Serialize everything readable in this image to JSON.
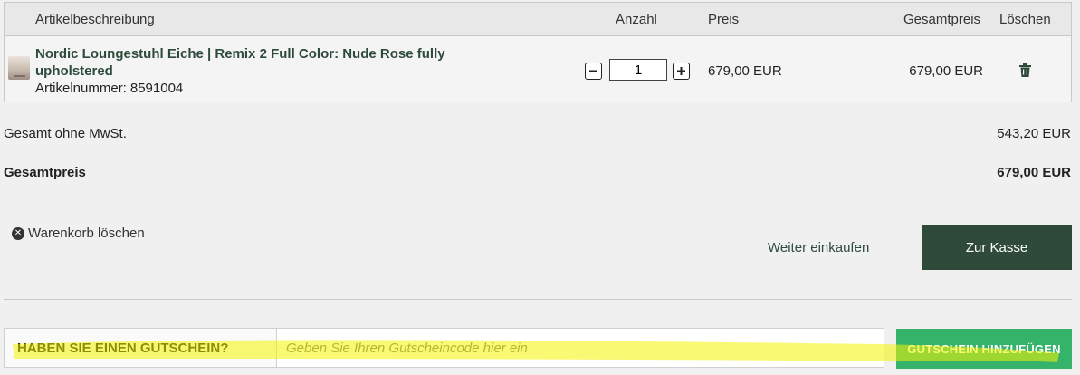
{
  "table": {
    "headers": {
      "description": "Artikelbeschreibung",
      "quantity": "Anzahl",
      "price": "Preis",
      "total": "Gesamtpreis",
      "delete": "Löschen"
    },
    "rows": [
      {
        "name": "Nordic Loungestuhl Eiche | Remix 2 Full Color: Nude Rose fully upholstered",
        "sku_label": "Artikelnummer:",
        "sku": "8591004",
        "quantity": "1",
        "unit_price": "679,00 EUR",
        "line_total": "679,00 EUR",
        "delete_icon": "trash-icon",
        "minus_icon": "minus-icon",
        "plus_icon": "plus-icon"
      }
    ]
  },
  "summary": {
    "net_label": "Gesamt ohne MwSt.",
    "net_value": "543,20 EUR",
    "gross_label": "Gesamtpreis",
    "gross_value": "679,00 EUR"
  },
  "actions": {
    "clear_cart": "Warenkorb löschen",
    "clear_icon": "close-circle-icon",
    "continue_shopping": "Weiter einkaufen",
    "checkout": "Zur Kasse"
  },
  "coupon": {
    "label": "HABEN SIE EINEN GUTSCHEIN?",
    "placeholder": "Geben Sie Ihren Gutscheincode hier ein",
    "button": "GUTSCHEIN HINZUFÜGEN"
  },
  "colors": {
    "brand_green": "#2f4a3a",
    "coupon_button": "#36b36b",
    "highlighter": "#f4f400"
  }
}
